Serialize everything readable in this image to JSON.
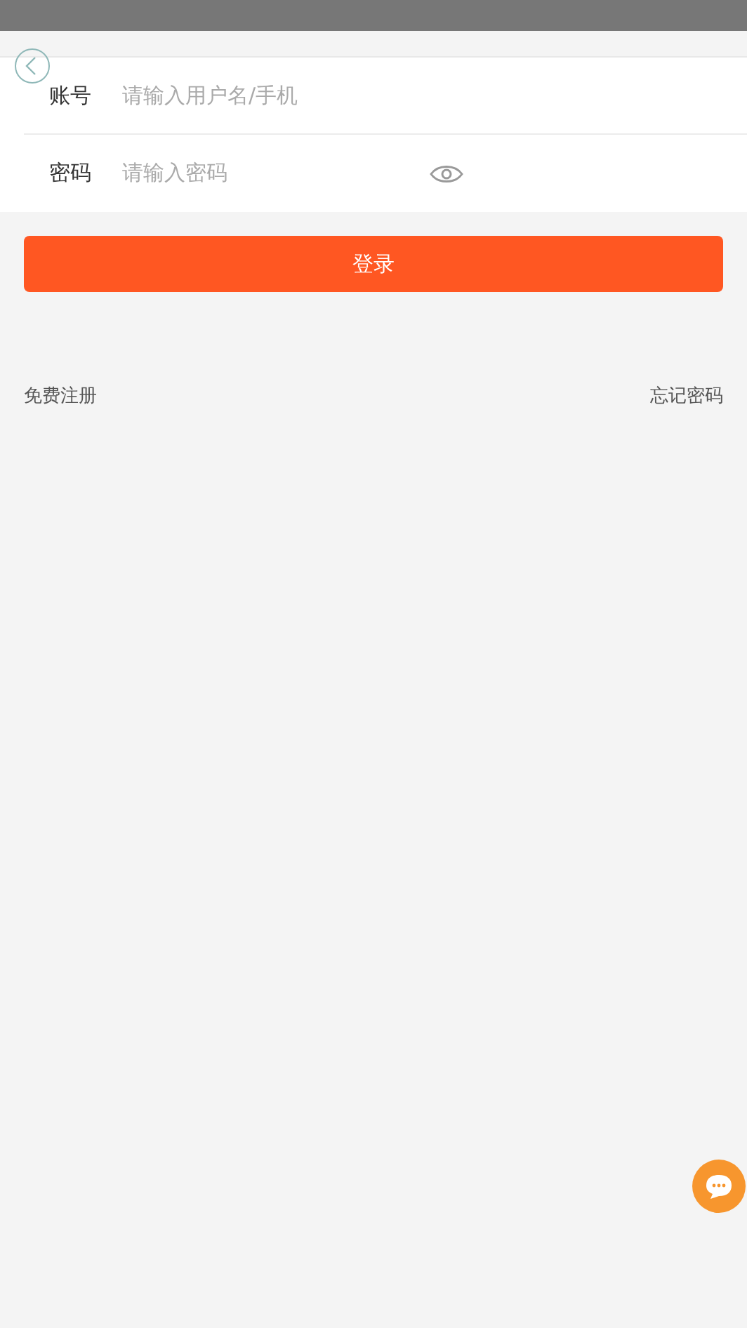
{
  "form": {
    "fields": [
      {
        "label": "账号",
        "placeholder": "请输入用户名/手机",
        "kind": "text"
      },
      {
        "label": "密码",
        "placeholder": "请输入密码",
        "kind": "password"
      }
    ]
  },
  "login_button": "登录",
  "links": {
    "register": "免费注册",
    "forgot_password": "忘记密码"
  }
}
